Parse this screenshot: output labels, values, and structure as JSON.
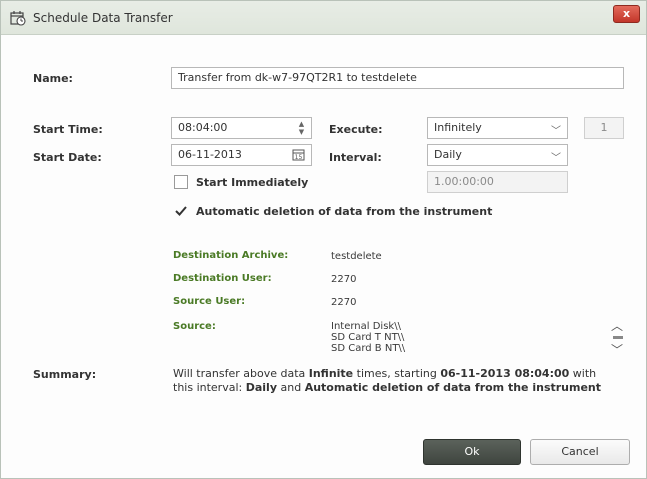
{
  "window": {
    "title": "Schedule Data Transfer",
    "close_glyph": "x"
  },
  "form": {
    "name_label": "Name:",
    "name_value": "Transfer from dk-w7-97QT2R1 to testdelete",
    "start_time_label": "Start Time:",
    "start_time_value": "08:04:00",
    "start_date_label": "Start Date:",
    "start_date_value": "06-11-2013",
    "execute_label": "Execute:",
    "execute_value": "Infinitely",
    "execute_count": "1",
    "interval_label": "Interval:",
    "interval_value": "Daily",
    "interval_duration": "1.00:00:00",
    "start_immediately_label": "Start Immediately",
    "start_immediately_checked": false,
    "auto_delete_label": "Automatic deletion of data from the instrument",
    "auto_delete_checked": true
  },
  "details": {
    "destination_archive_label": "Destination Archive:",
    "destination_archive_value": "testdelete",
    "destination_user_label": "Destination User:",
    "destination_user_value": "2270",
    "source_user_label": "Source User:",
    "source_user_value": "2270",
    "source_label": "Source:",
    "source_items": [
      "Internal Disk\\\\",
      "SD Card T NT\\\\",
      "SD Card B NT\\\\"
    ]
  },
  "summary": {
    "label": "Summary:",
    "p1": "Will transfer above data",
    "b1": "Infinite",
    "p2": "times, starting",
    "b2": "06-11-2013 08:04:00",
    "p3": "with this interval:",
    "b3": "Daily",
    "p4": "and",
    "b4": "Automatic deletion of data from the instrument"
  },
  "buttons": {
    "ok": "Ok",
    "cancel": "Cancel"
  },
  "colors": {
    "accent_green": "#4a7a25",
    "ok_button": "#4a504a",
    "close_red": "#c2362a"
  },
  "icons": {
    "title": "calendar-clock-icon",
    "date_picker": "calendar-icon",
    "checkmark": "checkmark-icon"
  }
}
